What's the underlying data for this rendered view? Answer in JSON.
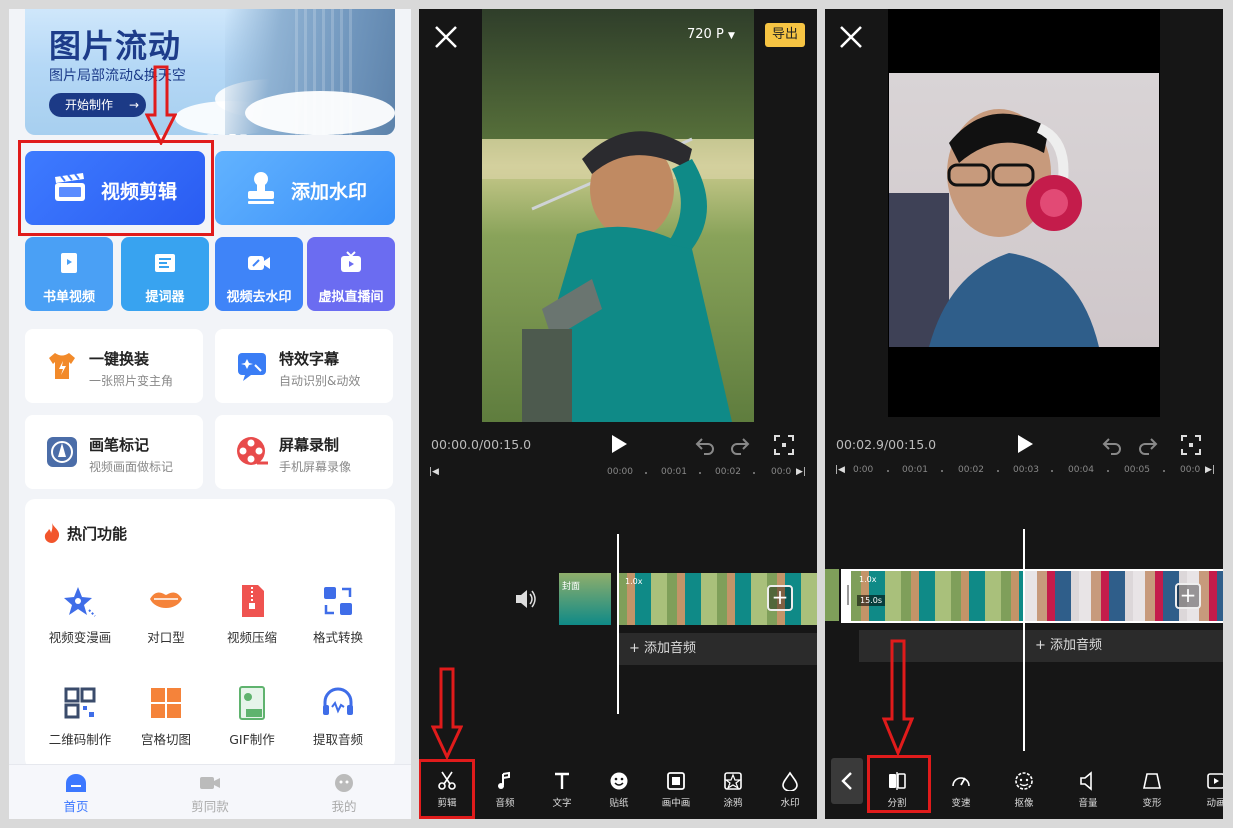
{
  "panel1": {
    "banner": {
      "title": "图片流动",
      "subtitle": "图片局部流动&换天空",
      "button": "开始制作"
    },
    "main_buttons": [
      "视频剪辑",
      "添加水印"
    ],
    "tiles": [
      "书单视频",
      "提词器",
      "视频去水印",
      "虚拟直播间"
    ],
    "tile_colors": [
      "#4aa0f5",
      "#38a3f0",
      "#3f84f8",
      "#6b6cf1"
    ],
    "cards": [
      {
        "title": "一键换装",
        "subtitle": "一张照片变主角",
        "icon": "shirt-icon"
      },
      {
        "title": "特效字幕",
        "subtitle": "自动识别&动效",
        "icon": "subtitle-icon"
      },
      {
        "title": "画笔标记",
        "subtitle": "视频画面做标记",
        "icon": "pen-icon"
      },
      {
        "title": "屏幕录制",
        "subtitle": "手机屏幕录像",
        "icon": "film-reel-icon"
      }
    ],
    "hot": {
      "title": "热门功能",
      "items": [
        "视频变漫画",
        "对口型",
        "视频压缩",
        "格式转换",
        "二维码制作",
        "宫格切图",
        "GIF制作",
        "提取音频"
      ]
    },
    "tabs": [
      "首页",
      "剪同款",
      "我的"
    ]
  },
  "panel2": {
    "resolution": "720 P",
    "export_label": "导出",
    "time": "00:00.0/00:15.0",
    "ruler": [
      "00:00",
      "00:01",
      "00:02",
      "00:0"
    ],
    "cover_label": "封面",
    "speed": "1.0x",
    "add_audio": "+ 添加音频",
    "tools": [
      "剪辑",
      "音频",
      "文字",
      "贴纸",
      "画中画",
      "涂鸦",
      "水印"
    ]
  },
  "panel3": {
    "time": "00:02.9/00:15.0",
    "ruler": [
      "0:00",
      "00:01",
      "00:02",
      "00:03",
      "00:04",
      "00:05",
      "00:0"
    ],
    "speed": "1.0x",
    "duration": "15.0s",
    "add_audio": "+ 添加音频",
    "tools": [
      "分割",
      "变速",
      "抠像",
      "音量",
      "变形",
      "动画"
    ]
  }
}
